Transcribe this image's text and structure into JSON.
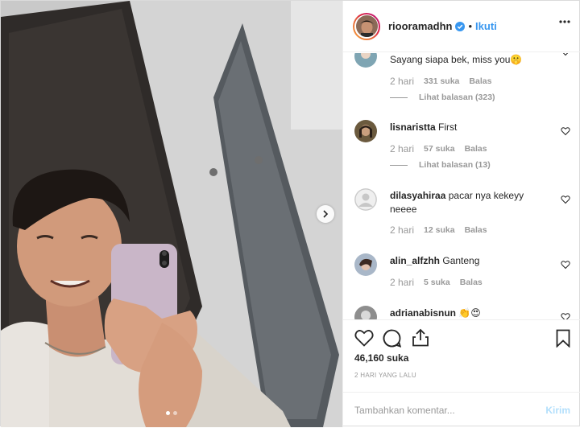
{
  "post": {
    "username": "riooramadhn",
    "separator": "•",
    "follow_label": "Ikuti",
    "more_icon": "more-horizontal-icon",
    "like_count": "46,160 suka",
    "time_ago": "2 HARI YANG LALU",
    "carousel": {
      "dots": 2,
      "active_index": 0
    }
  },
  "comments": [
    {
      "username": "",
      "text": "Sayang siapa bek, miss you🤫",
      "time": "2 hari",
      "likes": "331 suka",
      "reply_label": "Balas",
      "view_replies": "Lihat balasan (323)"
    },
    {
      "username": "lisnaristta",
      "text": "First",
      "time": "2 hari",
      "likes": "57 suka",
      "reply_label": "Balas",
      "view_replies": "Lihat balasan (13)"
    },
    {
      "username": "dilasyahiraa",
      "text": "pacar nya kekeyy neeee",
      "time": "2 hari",
      "likes": "12 suka",
      "reply_label": "Balas"
    },
    {
      "username": "alin_alfzhh",
      "text": "Ganteng",
      "time": "2 hari",
      "likes": "5 suka",
      "reply_label": "Balas"
    },
    {
      "username": "adrianabisnun",
      "text": "👏😍"
    }
  ],
  "composer": {
    "placeholder": "Tambahkan komentar...",
    "send_label": "Kirim"
  },
  "colors": {
    "link_blue": "#3897f0",
    "send_disabled": "#b2dffc",
    "muted": "#999999",
    "text": "#262626"
  }
}
